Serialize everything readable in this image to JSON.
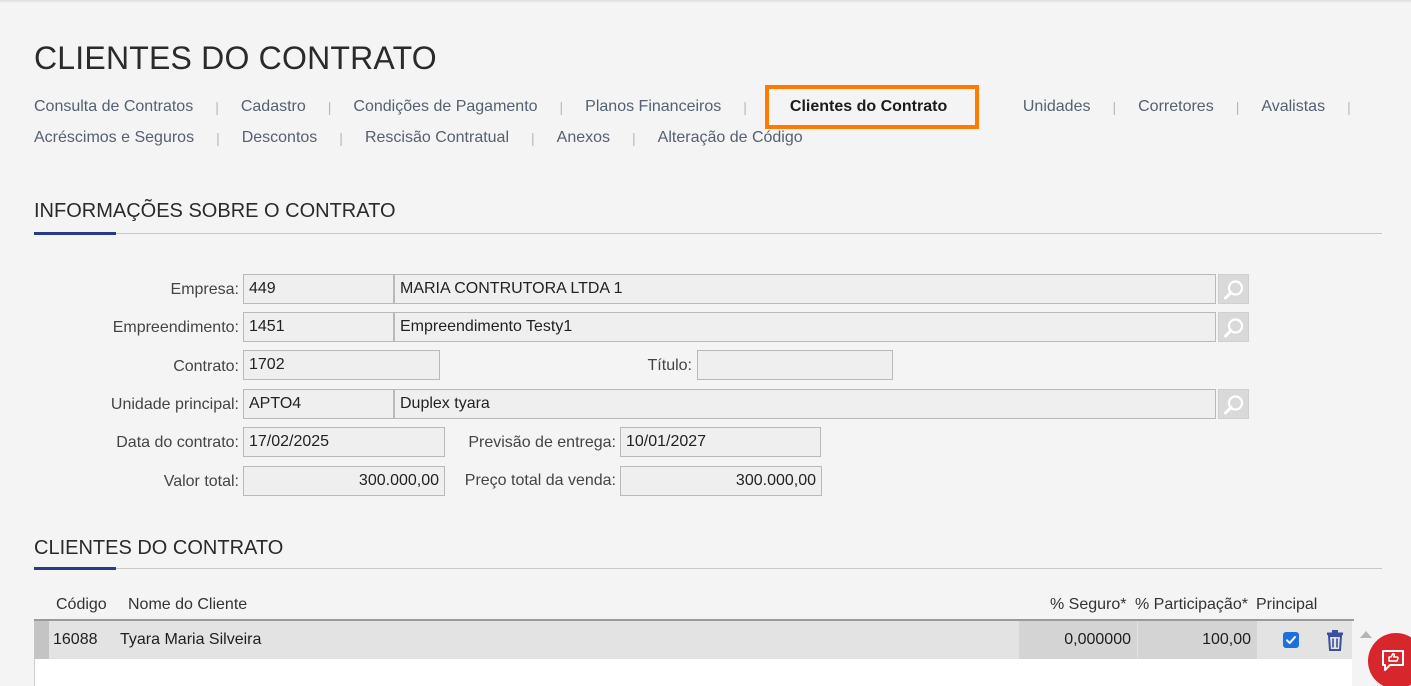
{
  "page": {
    "title": "CLIENTES DO CONTRATO"
  },
  "nav": {
    "row1": [
      "Consulta de Contratos",
      "Cadastro",
      "Condições de Pagamento",
      "Planos Financeiros",
      "Clientes do Contrato",
      "Unidades",
      "Corretores",
      "Avalistas"
    ],
    "row2": [
      "Acréscimos e Seguros",
      "Descontos",
      "Rescisão Contratual",
      "Anexos",
      "Alteração de Código"
    ],
    "active": "Clientes do Contrato",
    "active_color": "#ff7a00"
  },
  "info": {
    "title": "INFORMAÇÕES SOBRE O CONTRATO",
    "empresa": {
      "label": "Empresa:",
      "code": "449",
      "name": "MARIA CONTRUTORA LTDA 1"
    },
    "empreendimento": {
      "label": "Empreendimento:",
      "code": "1451",
      "name": "Empreendimento Testy1"
    },
    "contrato": {
      "label": "Contrato:",
      "value": "1702"
    },
    "titulo": {
      "label": "Título:",
      "value": ""
    },
    "unidade": {
      "label": "Unidade principal:",
      "code": "APTO4",
      "name": "Duplex tyara"
    },
    "data_contrato": {
      "label": "Data do contrato:",
      "value": "17/02/2025"
    },
    "previsao": {
      "label": "Previsão de entrega:",
      "value": "10/01/2027"
    },
    "valor_total": {
      "label": "Valor total:",
      "value": "300.000,00"
    },
    "preco_total": {
      "label": "Preço total da venda:",
      "value": "300.000,00"
    }
  },
  "clients": {
    "title": "CLIENTES DO CONTRATO",
    "columns": {
      "codigo": "Código",
      "nome": "Nome do Cliente",
      "seguro": "% Seguro*",
      "participacao": "% Participação*",
      "principal": "Principal"
    },
    "rows": [
      {
        "codigo": "16088",
        "nome": "Tyara Maria Silveira",
        "seguro": "0,000000",
        "participacao": "100,00",
        "principal": true
      }
    ]
  },
  "icons": {
    "search": "search-icon",
    "trash": "trash-icon",
    "feedback": "feedback-icon",
    "scroll_up": "scroll-up-icon"
  },
  "colors": {
    "accent": "#283a8a",
    "fab": "#d7262c",
    "checkbox": "#1e6fe0"
  }
}
